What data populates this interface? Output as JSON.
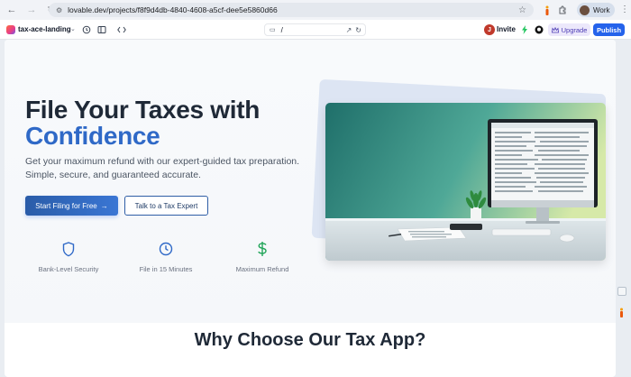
{
  "browser": {
    "url": "lovable.dev/projects/f8f9d4db-4840-4608-a5cf-dee5e5860d66",
    "profile_label": "Work"
  },
  "lovable": {
    "project_name": "tax-ace-landing",
    "path": "/",
    "invite_initial": "J",
    "invite_label": "Invite",
    "upgrade_label": "Upgrade",
    "publish_label": "Publish"
  },
  "hero": {
    "title_line1": "File Your Taxes with",
    "title_line2": "Confidence",
    "subtitle": "Get your maximum refund with our expert-guided tax preparation. Simple, secure, and guaranteed accurate.",
    "primary_button": "Start Filing for Free",
    "secondary_button": "Talk to a Tax Expert",
    "features": [
      {
        "label": "Bank-Level Security",
        "icon": "shield-icon",
        "color": "#2f69c7"
      },
      {
        "label": "File in 15 Minutes",
        "icon": "clock-icon",
        "color": "#2f69c7"
      },
      {
        "label": "Maximum Refund",
        "icon": "dollar-icon",
        "color": "#22a559"
      }
    ]
  },
  "section": {
    "heading": "Why Choose Our Tax App?"
  },
  "colors": {
    "accent": "#2f69c7",
    "publish": "#2563eb",
    "upgrade_bg": "#ece8fb"
  }
}
